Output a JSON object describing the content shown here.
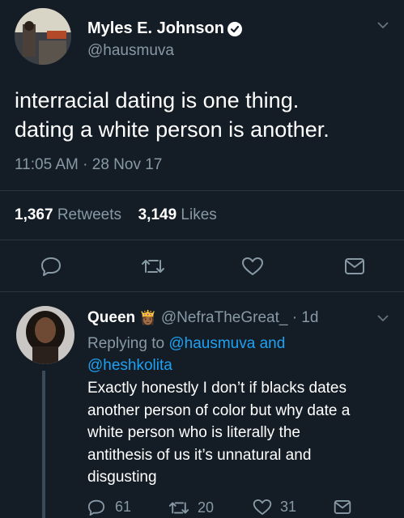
{
  "main_tweet": {
    "author_name": "Myles E. Johnson",
    "author_handle": "@hausmuva",
    "text_line1": "interracial dating is one thing.",
    "text_line2": "dating a white person is another.",
    "time": "11:05 AM",
    "separator": "·",
    "date": "28 Nov 17",
    "retweets_count": "1,367",
    "retweets_label": "Retweets",
    "likes_count": "3,149",
    "likes_label": "Likes"
  },
  "reply": {
    "author_name": "Queen",
    "emoji": "👸🏾",
    "author_handle": "@NefraTheGreat_",
    "separator": "·",
    "age": "1d",
    "replying_prefix": "Replying to",
    "replying_user1": "@hausmuva",
    "replying_and": "and",
    "replying_user2": "@heshkolita",
    "text_lines": [
      "Exactly honestly I don’t if blacks dates",
      "another person of color but why date a",
      "white person who is literally the",
      "antithesis of us it’s unnatural and",
      "disgusting"
    ],
    "reply_count": "61",
    "retweet_count": "20",
    "like_count": "31"
  },
  "colors": {
    "background": "#141d26",
    "accent": "#1da1f2",
    "muted": "#8899a6"
  }
}
